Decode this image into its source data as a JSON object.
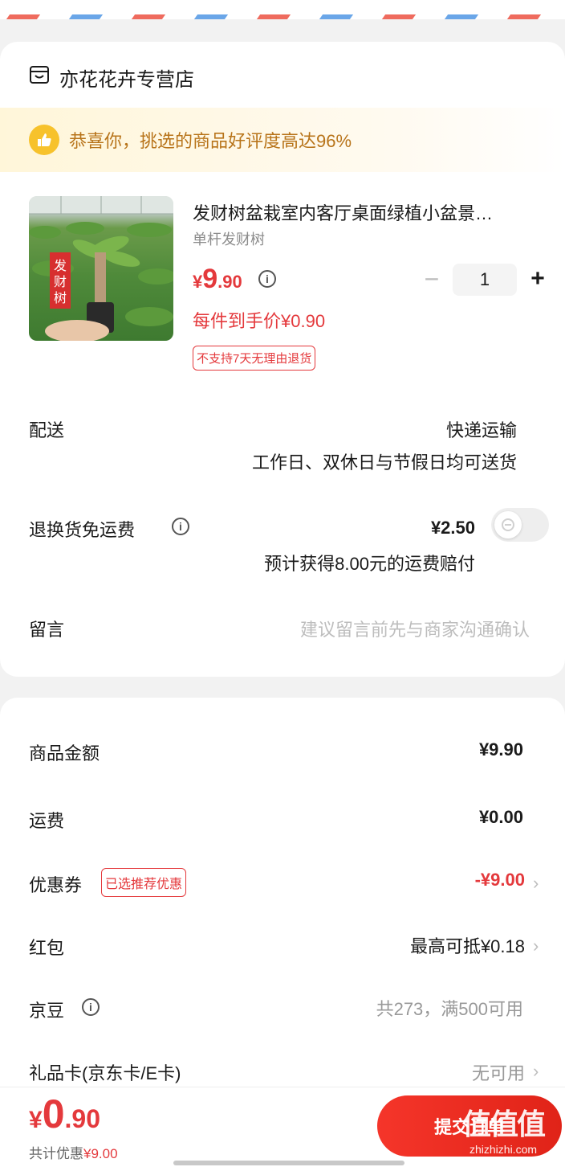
{
  "colors": {
    "accent": "#e4393c",
    "praise_text": "#b8741a",
    "muted": "#8c8c8c",
    "envelope_red": "#ef6b5e",
    "envelope_blue": "#6aa6e8"
  },
  "store": {
    "icon": "store-icon",
    "name": "亦花花卉专营店"
  },
  "praise": {
    "icon": "thumbs-up-icon",
    "text": "恭喜你，挑选的商品好评度高达96%"
  },
  "product": {
    "image_label": "发财树",
    "title": "发财树盆栽室内客厅桌面绿植小盆景…",
    "spec": "单杆发财树",
    "price_symbol": "¥",
    "price_int": "9",
    "price_dec": ".90",
    "final_price": "每件到手价¥0.90",
    "return_policy": "不支持7天无理由退货",
    "quantity": "1",
    "minus": "−",
    "plus": "+"
  },
  "delivery": {
    "label": "配送",
    "method": "快递运输",
    "schedule": "工作日、双休日与节假日均可送货"
  },
  "return_insurance": {
    "label": "退换货免运费",
    "price": "¥2.50",
    "note": "预计获得8.00元的运费赔付",
    "enabled": false
  },
  "message": {
    "label": "留言",
    "placeholder": "建议留言前先与商家沟通确认"
  },
  "summary": {
    "goods_amount": {
      "label": "商品金额",
      "value": "¥9.90"
    },
    "shipping": {
      "label": "运费",
      "value": "¥0.00"
    },
    "coupon": {
      "label": "优惠券",
      "badge": "已选推荐优惠",
      "value": "-¥9.00"
    },
    "red_packet": {
      "label": "红包",
      "value": "最高可抵¥0.18"
    },
    "jd_beans": {
      "label": "京豆",
      "value": "共273，满500可用"
    },
    "gift_card": {
      "label": "礼品卡(京东卡/E卡)",
      "value": "无可用"
    }
  },
  "footer": {
    "total_symbol": "¥",
    "total_int": "0",
    "total_dec": ".90",
    "saved_label": "共计优惠",
    "saved_value": "¥9.00",
    "submit": "提交订单",
    "watermark": "值值值",
    "watermark_url": "zhizhizhi.com"
  }
}
